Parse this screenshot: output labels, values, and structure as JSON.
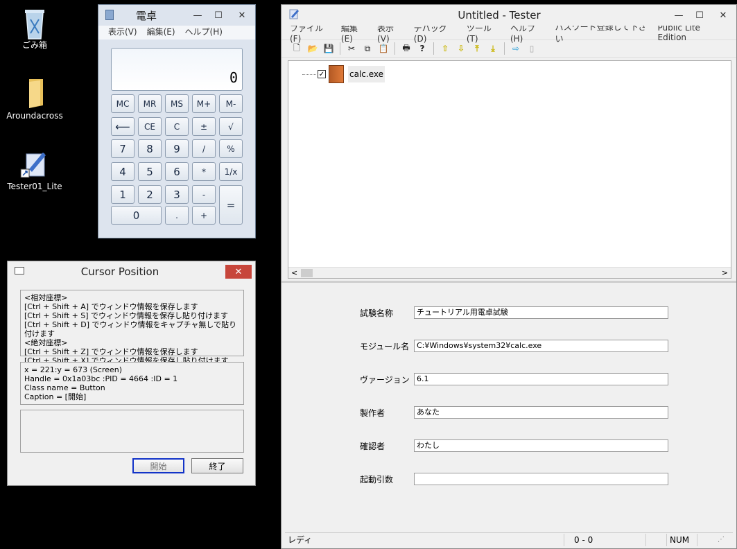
{
  "desktop": {
    "icons": [
      {
        "label": "ごみ箱",
        "icon": "recycle-bin-icon"
      },
      {
        "label": "Aroundacross",
        "icon": "folder-icon"
      },
      {
        "label": "Tester01_Lite",
        "icon": "shortcut-icon"
      }
    ]
  },
  "calc": {
    "title": "電卓",
    "menu": [
      "表示(V)",
      "編集(E)",
      "ヘルプ(H)"
    ],
    "display": "0",
    "buttons": {
      "mc": "MC",
      "mr": "MR",
      "ms": "MS",
      "mplus": "M+",
      "mminus": "M-",
      "back": "⟵",
      "ce": "CE",
      "c": "C",
      "sign": "±",
      "sqrt": "√",
      "n7": "7",
      "n8": "8",
      "n9": "9",
      "div": "/",
      "pct": "%",
      "n4": "4",
      "n5": "5",
      "n6": "6",
      "mul": "*",
      "recip": "1/x",
      "n1": "1",
      "n2": "2",
      "n3": "3",
      "minus": "-",
      "eq": "=",
      "n0": "0",
      "dot": ".",
      "plus": "+"
    }
  },
  "tester": {
    "title": "Untitled - Tester",
    "menu": [
      "ファイル(F)",
      "編集(E)",
      "表示(V)",
      "デバッグ(D)",
      "ツール(T)",
      "ヘルプ(H)",
      "パスワード登録して下さい"
    ],
    "edition": "Public Lite Edition",
    "tree_item": "calc.exe",
    "form": {
      "test_name_label": "試験名称",
      "test_name_value": "チュートリアル用電卓試験",
      "module_label": "モジュール名",
      "module_value": "C:¥Windows¥system32¥calc.exe",
      "version_label": "ヴァージョン",
      "version_value": "6.1",
      "author_label": "製作者",
      "author_value": "あなた",
      "reviewer_label": "確認者",
      "reviewer_value": "わたし",
      "args_label": "起動引数",
      "args_value": ""
    },
    "status": {
      "ready": "レディ",
      "position": "0 -    0",
      "num": "NUM"
    }
  },
  "cursor": {
    "title": "Cursor Position",
    "instructions": [
      "<相対座標>",
      "[Ctrl + Shift + A] でウィンドウ情報を保存します",
      "[Ctrl + Shift + S] でウィンドウ情報を保存し貼り付けます",
      "[Ctrl + Shift + D] でウィンドウ情報をキャプチャ無しで貼り付けます",
      "<絶対座標>",
      "[Ctrl + Shift + Z] でウィンドウ情報を保存します",
      "[Ctrl + Shift + X] でウィンドウ情報を保存し貼り付けます"
    ],
    "info": [
      "x =  221:y =  673   (Screen)",
      "Handle = 0x1a03bc  :PID = 4664  :ID = 1",
      "Class name = Button",
      "Caption = [開始]"
    ],
    "start_label": "開始",
    "end_label": "終了"
  }
}
